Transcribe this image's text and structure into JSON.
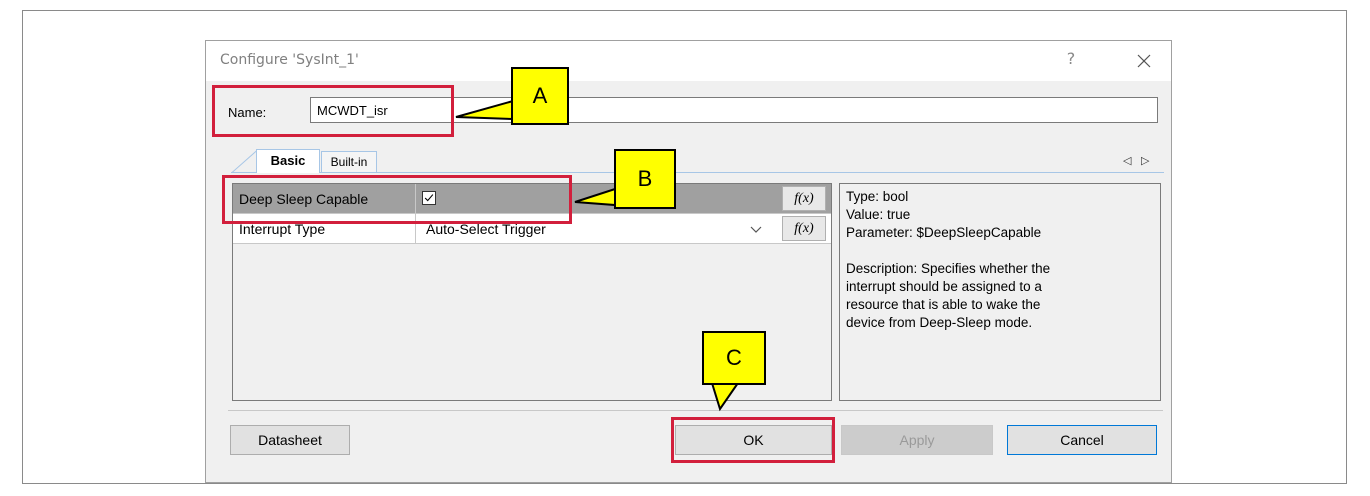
{
  "dialog": {
    "title": "Configure 'SysInt_1'",
    "help_label": "?"
  },
  "name_field": {
    "label": "Name:",
    "value": "MCWDT_isr"
  },
  "tabs": [
    {
      "label": "Basic",
      "selected": true
    },
    {
      "label": "Built-in",
      "selected": false
    }
  ],
  "tab_nav": {
    "left": "◁",
    "right": "▷"
  },
  "parameters": [
    {
      "name": "Deep Sleep Capable",
      "value": "",
      "checked": true,
      "fx": "f(x)",
      "selected": true
    },
    {
      "name": "Interrupt Type",
      "value": "Auto-Select Trigger",
      "fx": "f(x)",
      "selected": false
    }
  ],
  "description": {
    "type_line": "Type: bool",
    "value_line": "Value: true",
    "parameter_line": "Parameter: $DeepSleepCapable",
    "description_lines": [
      "Description: Specifies whether the",
      "interrupt should be assigned to a",
      "resource that is able to wake the",
      "device from Deep-Sleep mode."
    ]
  },
  "buttons": {
    "datasheet": "Datasheet",
    "ok": "OK",
    "apply": "Apply",
    "cancel": "Cancel"
  },
  "callouts": {
    "a": "A",
    "b": "B",
    "c": "C"
  },
  "colors": {
    "highlight": "#d21f3c",
    "callout_fill": "#ffff00",
    "selected_row": "#a0a0a0",
    "tab_border": "#a7c6e6",
    "cancel_border": "#0078d7"
  }
}
